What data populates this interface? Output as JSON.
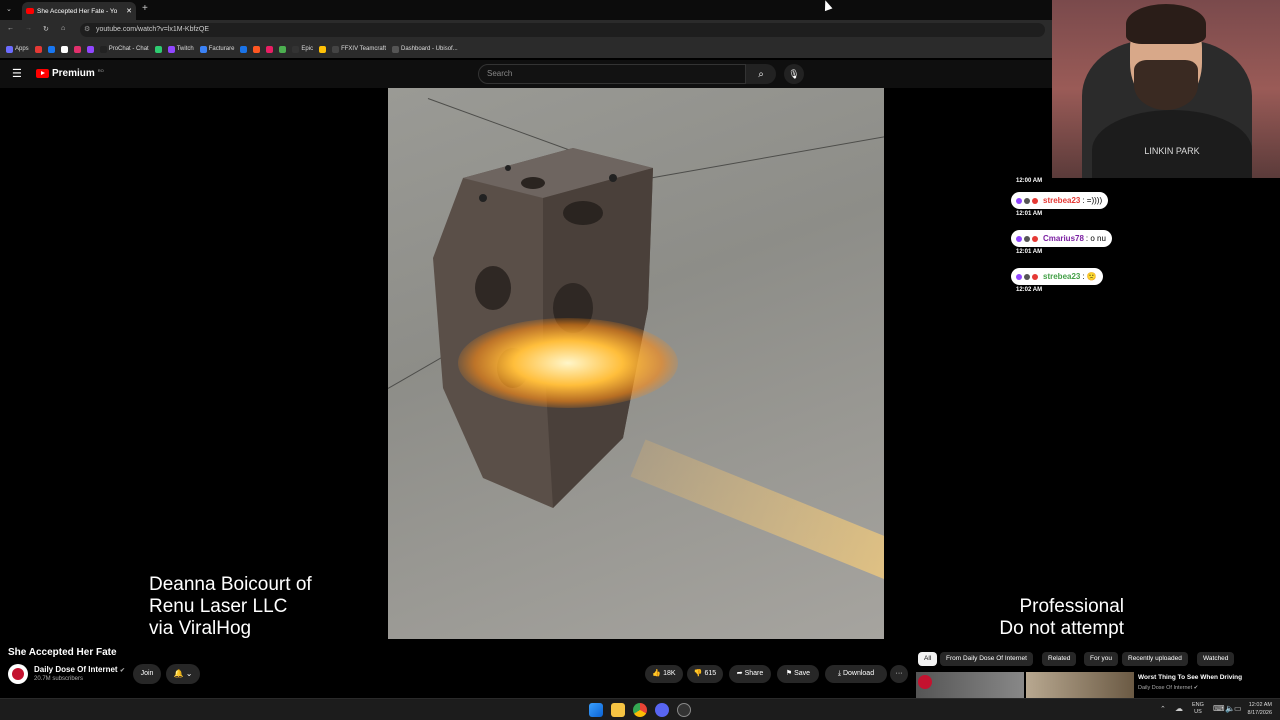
{
  "browser": {
    "tab_title": "She Accepted Her Fate - Yo",
    "url": "youtube.com/watch?v=lx1M-KbfzQE",
    "bookmarks": [
      {
        "label": "Apps",
        "color": "#6c6cff"
      },
      {
        "label": "",
        "color": "#e53935"
      },
      {
        "label": "",
        "color": "#1877f2"
      },
      {
        "label": "",
        "color": "#ffffff"
      },
      {
        "label": "",
        "color": "#e1306c"
      },
      {
        "label": "",
        "color": "#9146ff"
      },
      {
        "label": "ProChat - Chat",
        "color": "#222"
      },
      {
        "label": "",
        "color": "#2ecc71"
      },
      {
        "label": "Twitch",
        "color": "#9146ff"
      },
      {
        "label": "Facturare",
        "color": "#3b82f6"
      },
      {
        "label": "",
        "color": "#1a73e8"
      },
      {
        "label": "",
        "color": "#ff5722"
      },
      {
        "label": "",
        "color": "#e91e63"
      },
      {
        "label": "",
        "color": "#4caf50"
      },
      {
        "label": "Epic",
        "color": "#333"
      },
      {
        "label": "",
        "color": "#ffc107"
      },
      {
        "label": "FFXIV Teamcraft",
        "color": "#444"
      },
      {
        "label": "Dashboard - Ubisof...",
        "color": "#555"
      }
    ]
  },
  "youtube": {
    "logo_text": "Premium",
    "logo_superscript": "RO",
    "search_placeholder": "Search",
    "search_icon": "search-icon",
    "mic_icon": "mic-icon"
  },
  "video": {
    "caption_left": "Deanna Boicourt of\nRenu Laser LLC\nvia ViralHog",
    "caption_right": "Professional\nDo not attempt"
  },
  "webcam": {
    "shirt_text": "LINKIN PARK"
  },
  "chat": {
    "messages": [
      {
        "time_before": "12:00 AM",
        "user": "strebea23",
        "text": ": =))))",
        "user_color": "#e53935",
        "time_after": "12:01 AM"
      },
      {
        "user": "Cmarius78",
        "text": ": o nu",
        "user_color": "#7b1fa2",
        "time_after": "12:01 AM"
      },
      {
        "user": "strebea23",
        "text": ": 🙁",
        "user_color": "#43a047",
        "time_after": "12:02 AM"
      }
    ]
  },
  "meta": {
    "title": "She Accepted Her Fate",
    "channel": "Daily Dose Of Internet",
    "subscribers": "20.7M subscribers",
    "join_label": "Join",
    "likes": "18K",
    "dislikes": "615",
    "share_label": "Share",
    "save_label": "Save",
    "download_label": "Download",
    "more_label": "···"
  },
  "chips": [
    "All",
    "From Daily Dose Of Internet",
    "Related",
    "For you",
    "Recently uploaded",
    "Watched"
  ],
  "recommended": {
    "title": "Worst Thing To See When Driving",
    "channel": "Daily Dose Of Internet"
  },
  "taskbar": {
    "lang_line1": "ENG",
    "lang_line2": "US",
    "time": "12:02 AM",
    "date": "8/17/2026"
  }
}
